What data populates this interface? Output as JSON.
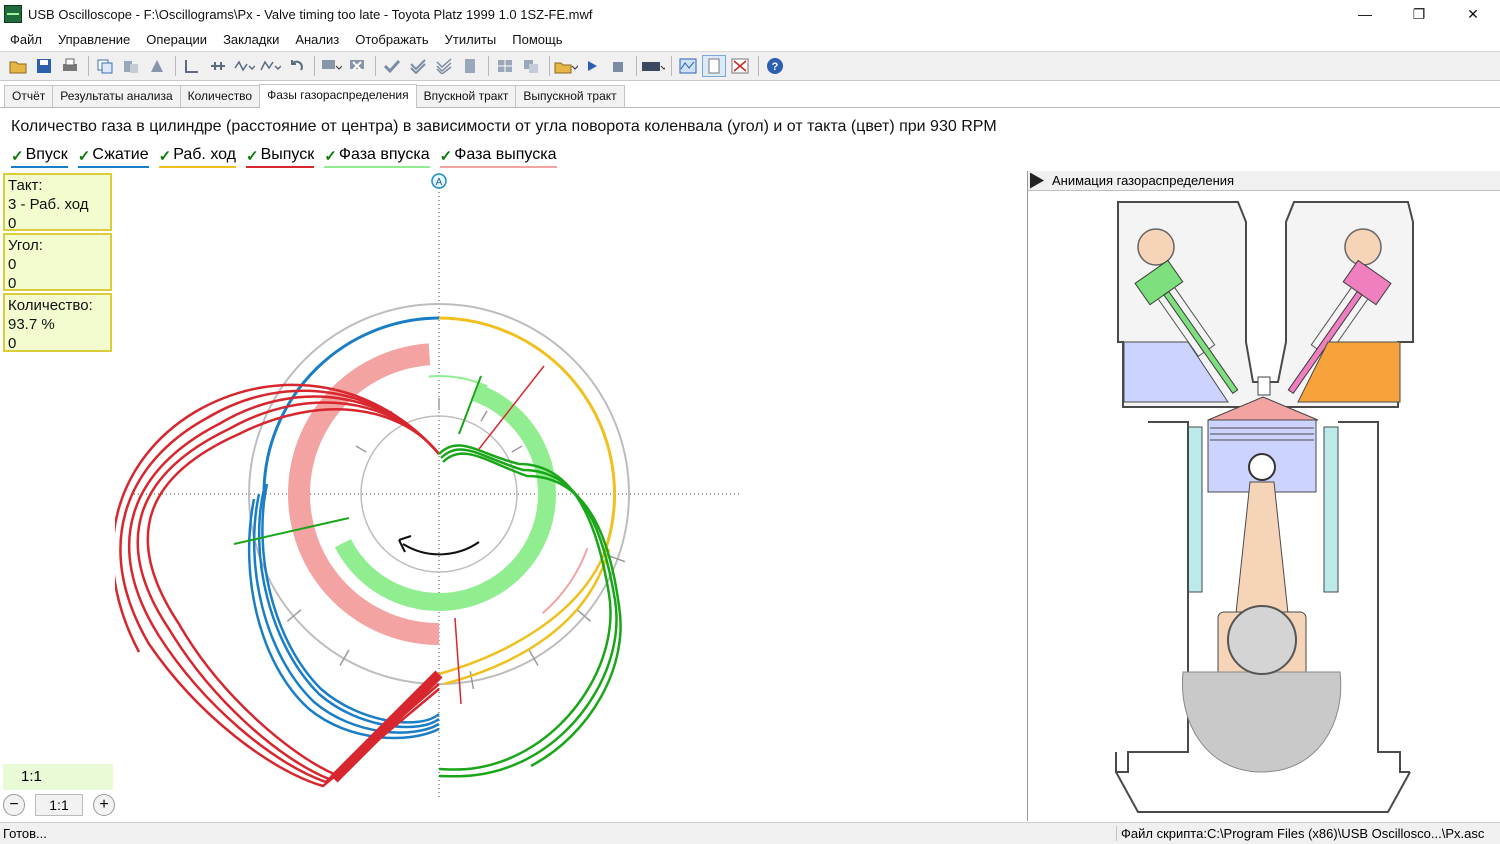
{
  "window": {
    "title": "USB Oscilloscope - F:\\Oscillograms\\Px - Valve timing too late - Toyota Platz 1999 1.0 1SZ-FE.mwf",
    "minimize": "—",
    "restore": "❐",
    "close": "✕"
  },
  "menu": [
    "Файл",
    "Управление",
    "Операции",
    "Закладки",
    "Анализ",
    "Отображать",
    "Утилиты",
    "Помощь"
  ],
  "toolbar_icons": [
    "open-folder-icon",
    "save-icon",
    "print-icon",
    "copy-icon",
    "paste-icon",
    "export-icon",
    "cursor-icon",
    "measure-icon",
    "wave-a-icon",
    "wave-b-icon",
    "undo-icon",
    "monitor-icon",
    "clear-icon",
    "check-icon",
    "double-check-icon",
    "triple-check-icon",
    "page-icon",
    "grid-icon",
    "layers-icon",
    "folder-icon",
    "play-icon",
    "stop-icon",
    "keyboard-icon",
    "oscillograph-icon",
    "document-icon",
    "close-chart-icon",
    "help-icon"
  ],
  "tabs": [
    {
      "label": "Отчёт",
      "active": false
    },
    {
      "label": "Результаты анализа",
      "active": false
    },
    {
      "label": "Количество",
      "active": false
    },
    {
      "label": "Фазы газораспределения",
      "active": true
    },
    {
      "label": "Впускной тракт",
      "active": false
    },
    {
      "label": "Выпускной тракт",
      "active": false
    }
  ],
  "heading": "Количество газа в цилиндре (расстояние от центра) в зависимости от угла поворота коленвала (угол) и от такта (цвет) при 930 RPM",
  "legend": [
    {
      "label": "Впуск",
      "color": "#1a7ec6"
    },
    {
      "label": "Сжатие",
      "color": "#1a7ec6"
    },
    {
      "label": "Раб. ход",
      "color": "#f0c020"
    },
    {
      "label": "Выпуск",
      "color": "#d8262e"
    },
    {
      "label": "Фаза впуска",
      "color": "#90ee90"
    },
    {
      "label": "Фаза выпуска",
      "color": "#f4a3a3"
    }
  ],
  "info": {
    "stroke_label": "Такт:",
    "stroke_value": "3 - Раб. ход",
    "stroke_extra": "0",
    "angle_label": "Угол:",
    "angle_value": "0",
    "angle_extra": "0",
    "qty_label": "Количество:",
    "qty_value": "93.7 %",
    "qty_extra": "0"
  },
  "zoom": {
    "label": "1:1",
    "value": "1:1",
    "minus": "−",
    "plus": "+"
  },
  "marker": "A",
  "animation_title": "Анимация газораспределения",
  "status": {
    "left": "Готов...",
    "right": "Файл скрипта:C:\\Program Files (x86)\\USB Oscillosco...\\Px.asc"
  },
  "colors": {
    "intake": "#1a7ec6",
    "compression": "#1a7ec6",
    "power": "#f0c020",
    "exhaust": "#d8262e",
    "intake_phase": "#90ee90",
    "exhaust_phase": "#f4a3a3",
    "intake_valve": "#7ddf7d",
    "exhaust_valve": "#ef7fbf",
    "intake_port": "#cdd3ff",
    "exhaust_port": "#f7a23a"
  }
}
